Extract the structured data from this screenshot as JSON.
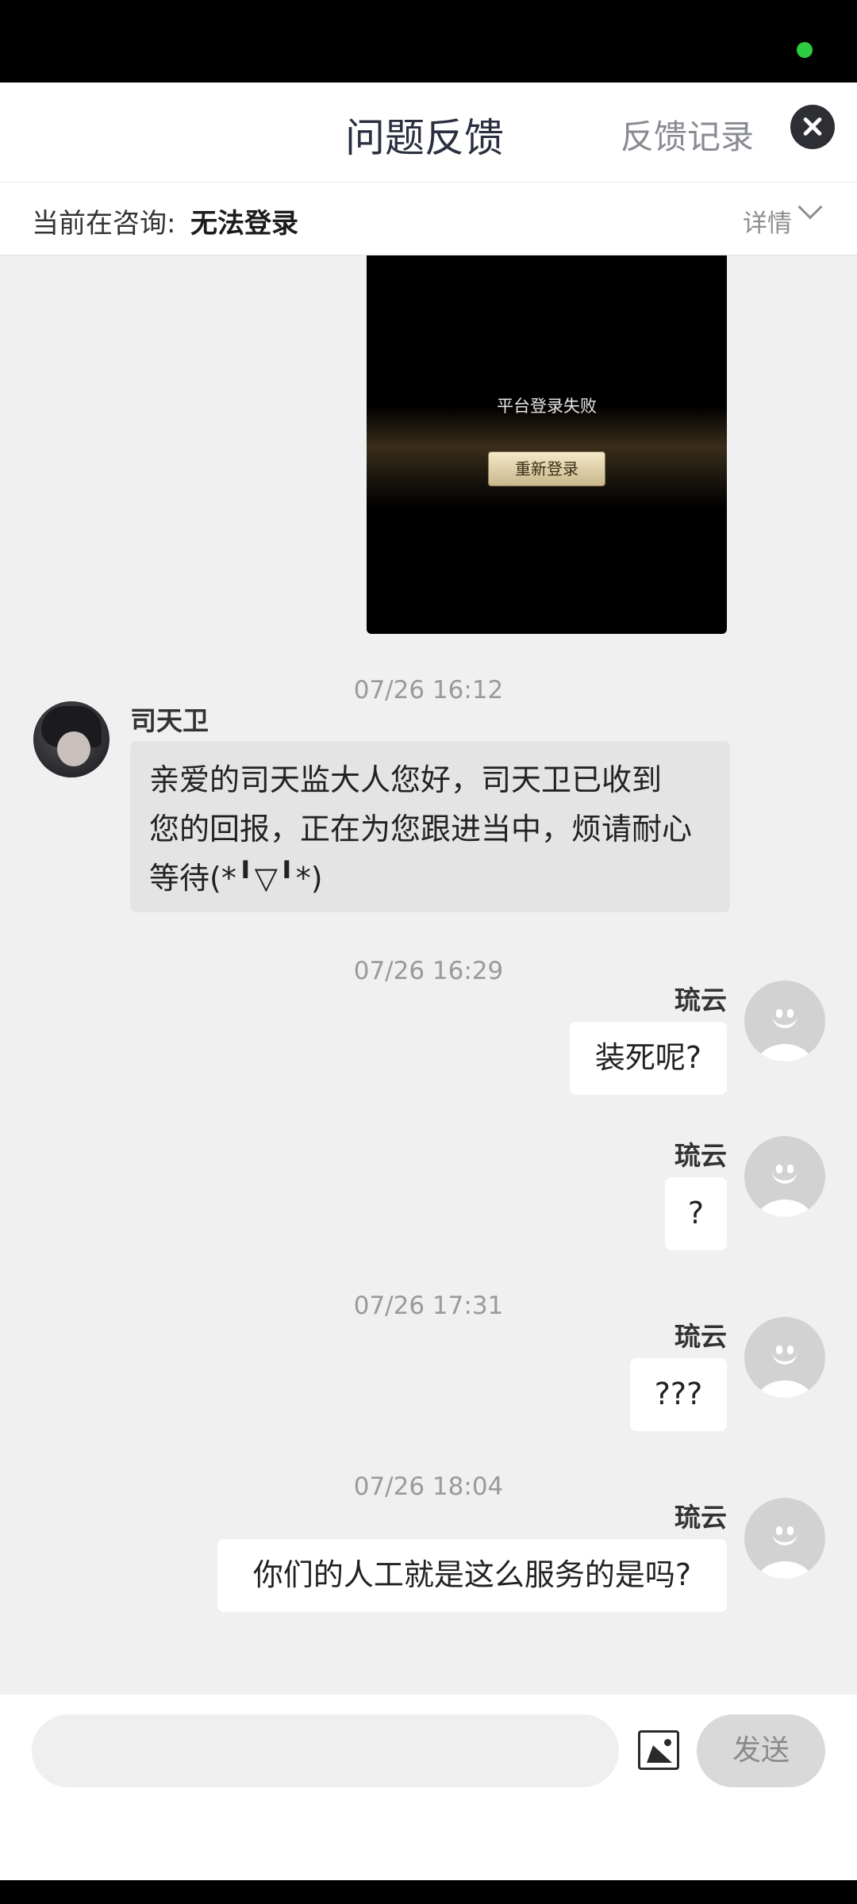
{
  "header": {
    "title": "问题反馈",
    "history_link": "反馈记录"
  },
  "topic": {
    "prefix": "当前在咨询:",
    "value": "无法登录",
    "details_label": "详情"
  },
  "screenshot_image": {
    "message": "平台登录失败",
    "button_label": "重新登录"
  },
  "messages": [
    {
      "timestamp": "07/26 16:12",
      "sender": "司天卫",
      "side": "left",
      "line1": "亲爱的司天监大人您好，司天卫已收到",
      "line2": "您的回报，正在为您跟进当中，烦请耐心",
      "line3": "等待(*╹▽╹*)"
    },
    {
      "timestamp": "07/26 16:29",
      "sender": "琉云",
      "side": "right",
      "text": "装死呢?"
    },
    {
      "sender": "琉云",
      "side": "right",
      "text": "?"
    },
    {
      "timestamp": "07/26 17:31",
      "sender": "琉云",
      "side": "right",
      "text": "???"
    },
    {
      "timestamp": "07/26 18:04",
      "sender": "琉云",
      "side": "right",
      "text": "你们的人工就是这么服务的是吗?"
    }
  ],
  "composer": {
    "input_value": "",
    "send_label": "发送"
  },
  "colors": {
    "chat_background": "#f0f0f0",
    "agent_bubble": "#e4e4e4",
    "user_bubble": "#ffffff",
    "status_dot": "#2ecc40"
  }
}
